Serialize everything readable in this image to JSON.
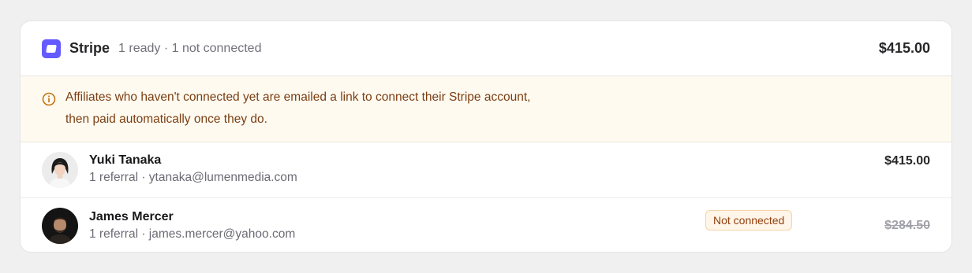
{
  "provider": {
    "name": "Stripe",
    "status": "1 ready · 1 not connected",
    "total": "$415.00",
    "logo_icon": "stripe-logo-icon",
    "brand_color": "#635bff"
  },
  "notice": {
    "icon": "info-circle-icon",
    "line1": "Affiliates who haven't connected yet are emailed a link to connect their Stripe account,",
    "line2": "then paid automatically once they do."
  },
  "affiliates": [
    {
      "name": "Yuki Tanaka",
      "meta": "1 referral · ytanaka@lumenmedia.com",
      "amount": "$415.00",
      "connected": true
    },
    {
      "name": "James Mercer",
      "meta": "1 referral · james.mercer@yahoo.com",
      "amount": "$284.50",
      "badge": "Not connected",
      "connected": false
    }
  ]
}
